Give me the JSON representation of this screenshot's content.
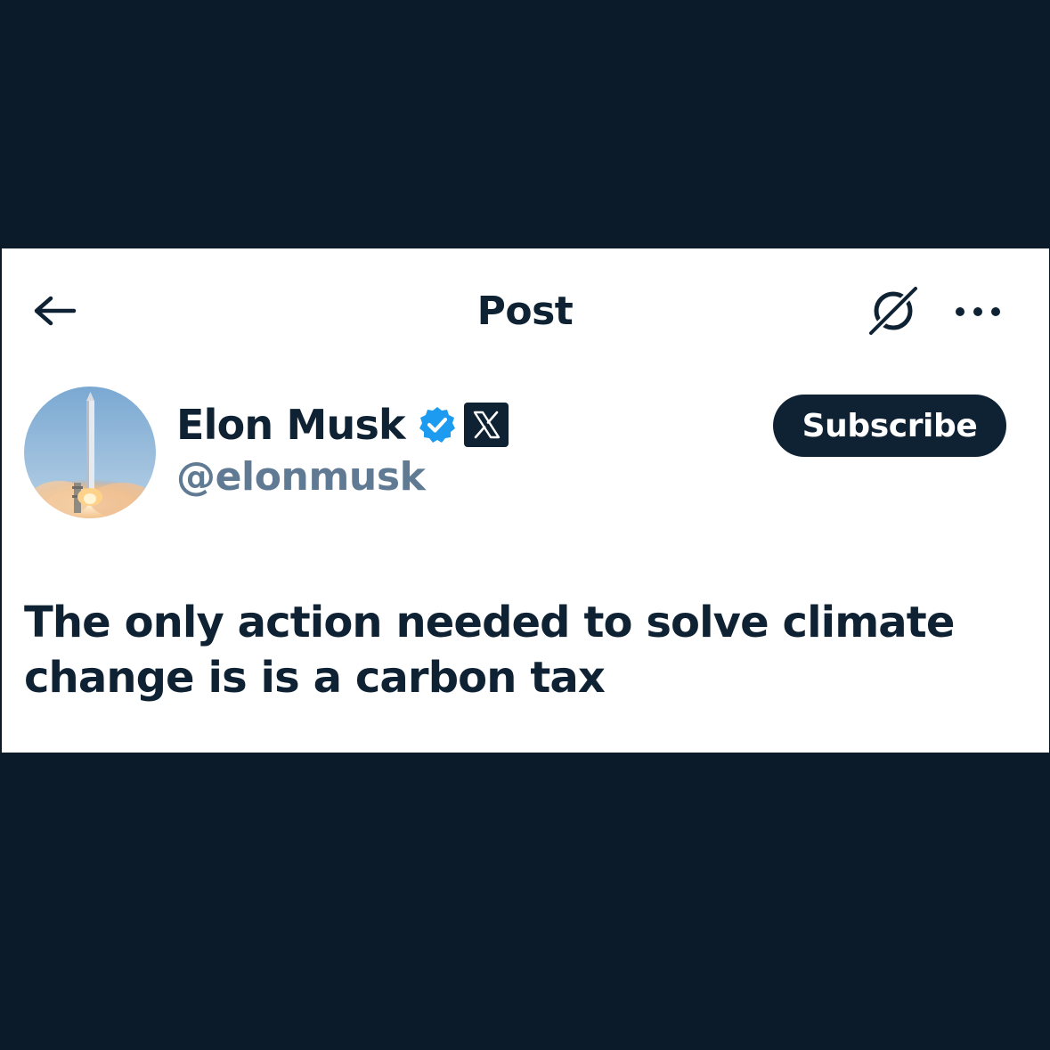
{
  "header": {
    "title": "Post",
    "back_icon": "arrow-left-icon",
    "grok_icon": "grok-icon",
    "more_icon": "more-horizontal-icon"
  },
  "author": {
    "display_name": "Elon Musk",
    "handle": "@elonmusk",
    "verified_icon": "verified-badge-icon",
    "affiliate_icon": "x-logo-icon",
    "avatar": "rocket-launch-avatar"
  },
  "actions": {
    "subscribe_label": "Subscribe"
  },
  "post": {
    "text": "The only action needed to solve climate change is is a carbon tax"
  },
  "colors": {
    "background": "#0c1b2a",
    "card": "#ffffff",
    "text_primary": "#0f2233",
    "text_secondary": "#5f7a92",
    "verified_blue": "#1d9bf0"
  }
}
